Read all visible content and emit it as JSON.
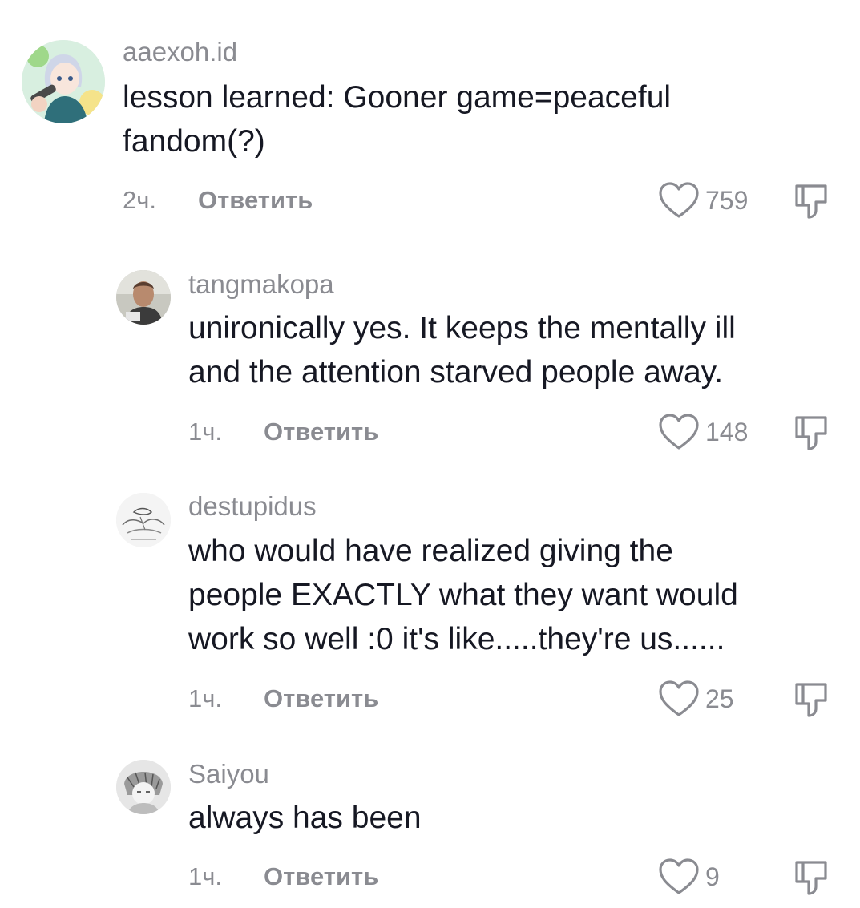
{
  "comments": [
    {
      "username": "aaexoh.id",
      "text": "lesson learned: Gooner game=peaceful\nfandom(?)",
      "time": "2ч.",
      "reply_label": "Ответить",
      "likes": "759",
      "avatar_icon": "anime-character-avatar"
    },
    {
      "username": "tangmakopa",
      "text": "unironically yes. It keeps the mentally ill\nand the attention starved people away.",
      "time": "1ч.",
      "reply_label": "Ответить",
      "likes": "148",
      "avatar_icon": "man-photo-avatar"
    },
    {
      "username": "destupidus",
      "text": "who would have realized giving the\npeople EXACTLY what they want would\nwork so well :0 it's like.....they're us......",
      "time": "1ч.",
      "reply_label": "Ответить",
      "likes": "25",
      "avatar_icon": "sketch-drawing-avatar"
    },
    {
      "username": "Saiyou",
      "text": "always has been",
      "time": "1ч.",
      "reply_label": "Ответить",
      "likes": "9",
      "avatar_icon": "manga-character-avatar"
    }
  ],
  "colors": {
    "text": "#161823",
    "secondary": "#8a8b91"
  }
}
